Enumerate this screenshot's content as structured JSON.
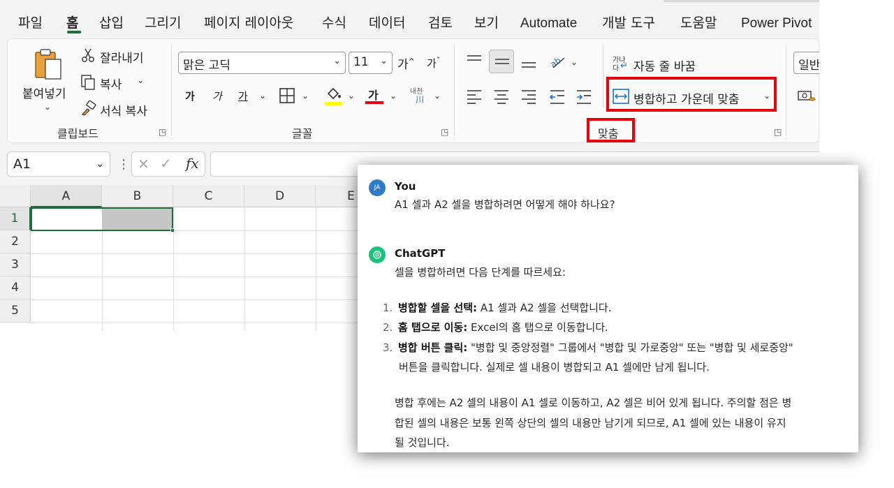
{
  "menu": {
    "tabs": [
      "파일",
      "홈",
      "삽입",
      "그리기",
      "페이지 레이아웃",
      "수식",
      "데이터",
      "검토",
      "보기",
      "Automate",
      "개발 도구",
      "도움말",
      "Power Pivot"
    ],
    "active_tab": "홈"
  },
  "ribbon": {
    "clipboard": {
      "paste": "붙여넣기",
      "cut": "잘라내기",
      "copy": "복사",
      "format_painter": "서식 복사",
      "group_label": "클립보드"
    },
    "font": {
      "font_name": "맑은 고딕",
      "font_size": "11",
      "grow_font": "가",
      "shrink_font": "가",
      "bold": "가",
      "italic": "가",
      "underline": "가",
      "font_color_glyph": "가",
      "phonetic_top": "내천",
      "phonetic_bottom": "川",
      "group_label": "글꼴",
      "fill_color": "#ffff00",
      "font_color": "#e8000d"
    },
    "alignment": {
      "wrap_text": "자동 줄 바꿈",
      "merge_center": "병합하고 가운데 맞춤",
      "group_label": "맞춤",
      "wrap_icon_top": "가나",
      "wrap_icon_bottom": "다"
    },
    "number": {
      "format": "일반"
    }
  },
  "formula_bar": {
    "name_box": "A1",
    "fx": "fx"
  },
  "grid": {
    "columns": [
      "A",
      "B",
      "C",
      "D",
      "E"
    ],
    "rows": [
      "1",
      "2",
      "3",
      "4",
      "5"
    ]
  },
  "chat": {
    "user": {
      "initials": "JA",
      "name": "You",
      "message": "A1 셀과 A2 셀을 병합하려면 어떻게 해야 하나요?"
    },
    "assistant": {
      "name": "ChatGPT",
      "intro": "셀을 병합하려면 다음 단계를 따르세요:",
      "steps": [
        {
          "num": "1.",
          "title": "병합할 셀을 선택:",
          "text": " A1 셀과 A2 셀을 선택합니다."
        },
        {
          "num": "2.",
          "title": "홈 탭으로 이동:",
          "text": " Excel의 홈 탭으로 이동합니다."
        },
        {
          "num": "3.",
          "title": "병합 버튼 클릭:",
          "text": " \"병합 및 중앙정렬\" 그룹에서 \"병합 및 가로중앙\" 또는 \"병합 및 세로중앙\"",
          "text2": "버튼을 클릭합니다. 실제로 셀 내용이 병합되고 A1 셀에만 남게 됩니다."
        }
      ],
      "closing": [
        "병합 후에는 A2 셀의 내용이 A1 셀로 이동하고, A2 셀은 비어 있게 됩니다. 주의할 점은 병",
        "합된 셀의 내용은 보통 왼쪽 상단의 셀의 내용만 남기게 되므로, A1 셀에 있는 내용이 유지",
        "될 것입니다."
      ]
    }
  },
  "colors": {
    "accent_green": "#1e6d3b",
    "highlight_red": "#e8000d",
    "selection_gray": "#c6c6c6"
  }
}
